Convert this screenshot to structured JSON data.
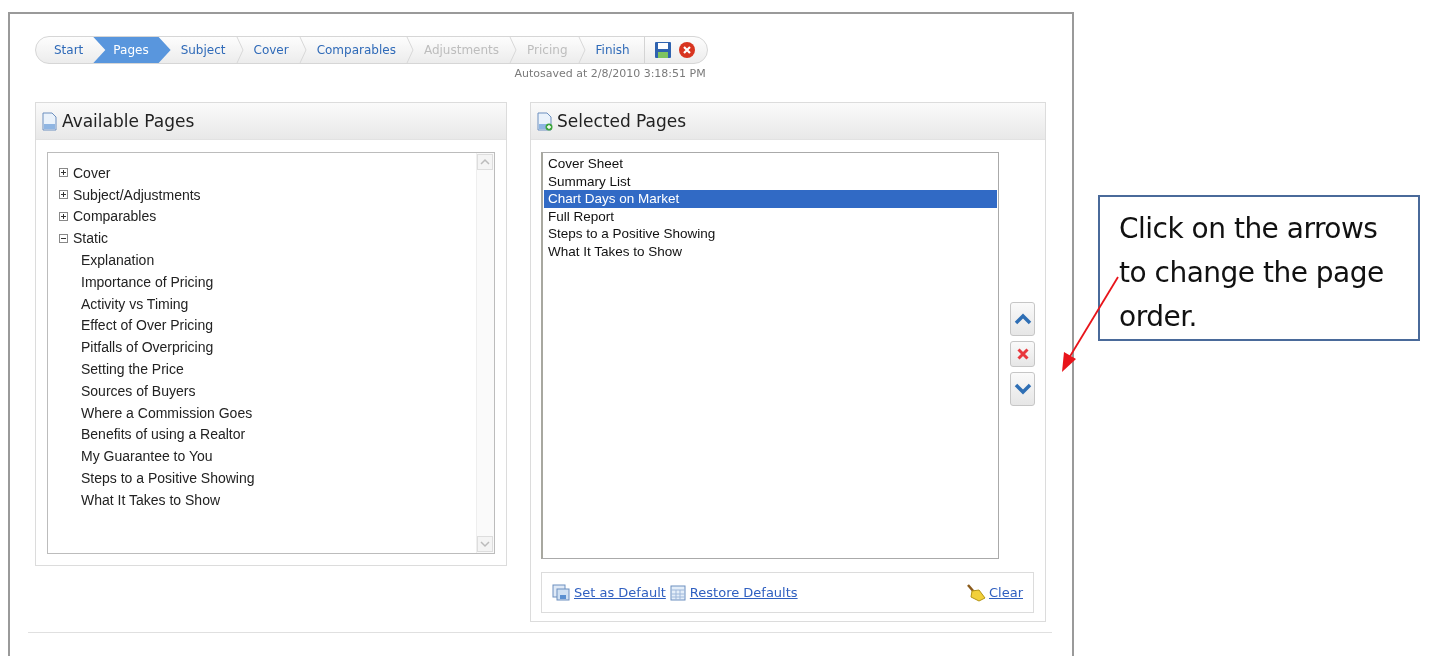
{
  "wizard_steps": [
    {
      "label": "Start",
      "selected": false,
      "disabled": false
    },
    {
      "label": "Pages",
      "selected": true,
      "disabled": false
    },
    {
      "label": "Subject",
      "selected": false,
      "disabled": false
    },
    {
      "label": "Cover",
      "selected": false,
      "disabled": false
    },
    {
      "label": "Comparables",
      "selected": false,
      "disabled": false
    },
    {
      "label": "Adjustments",
      "selected": false,
      "disabled": true
    },
    {
      "label": "Pricing",
      "selected": false,
      "disabled": true
    },
    {
      "label": "Finish",
      "selected": false,
      "disabled": false
    }
  ],
  "autosave_status": "Autosaved at 2/8/2010 3:18:51 PM",
  "available_pages": {
    "title": "Available Pages",
    "tree": [
      {
        "label": "Cover",
        "expanded": false
      },
      {
        "label": "Subject/Adjustments",
        "expanded": false
      },
      {
        "label": "Comparables",
        "expanded": false
      },
      {
        "label": "Static",
        "expanded": true,
        "children": [
          {
            "label": "Explanation"
          },
          {
            "label": "Importance of Pricing"
          },
          {
            "label": "Activity vs Timing"
          },
          {
            "label": "Effect of Over Pricing"
          },
          {
            "label": "Pitfalls of Overpricing"
          },
          {
            "label": "Setting the Price"
          },
          {
            "label": "Sources of Buyers"
          },
          {
            "label": "Where a Commission Goes"
          },
          {
            "label": "Benefits of using a Realtor"
          },
          {
            "label": "My Guarantee to You"
          },
          {
            "label": "Steps to a Positive Showing"
          },
          {
            "label": "What It Takes to Show"
          }
        ]
      }
    ]
  },
  "selected_pages": {
    "title": "Selected Pages",
    "items": [
      {
        "label": "Cover Sheet",
        "selected": false
      },
      {
        "label": "Summary List",
        "selected": false
      },
      {
        "label": "Chart Days on Market",
        "selected": true
      },
      {
        "label": "Full Report",
        "selected": false
      },
      {
        "label": "Steps to a Positive Showing",
        "selected": false
      },
      {
        "label": "What It Takes to Show",
        "selected": false
      }
    ],
    "footer_links": [
      {
        "kind": "set-default",
        "label": "Set as Default"
      },
      {
        "kind": "restore",
        "label": "Restore Defaults"
      },
      {
        "kind": "clear",
        "label": "Clear"
      }
    ]
  },
  "callout": {
    "text": "Click on the arrows to change the page order."
  }
}
